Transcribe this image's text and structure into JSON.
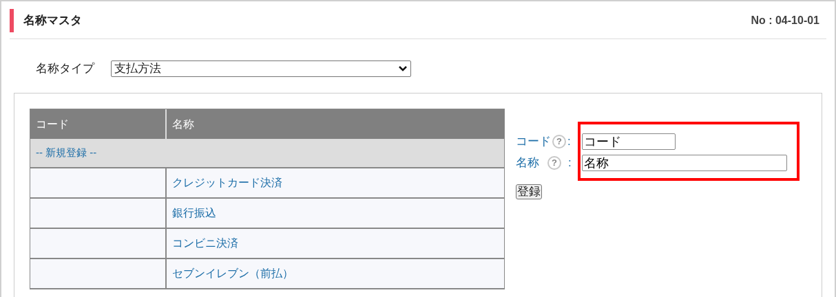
{
  "header": {
    "title": "名称マスタ",
    "screen_no": "No : 04-10-01"
  },
  "name_type": {
    "label": "名称タイプ",
    "value": "支払方法"
  },
  "table": {
    "columns": [
      "コード",
      "名称"
    ],
    "new_entry": "-- 新規登録 --",
    "rows": [
      {
        "code": "",
        "name": "クレジットカード決済"
      },
      {
        "code": "",
        "name": "銀行振込"
      },
      {
        "code": "",
        "name": "コンビニ決済"
      },
      {
        "code": "",
        "name": "セブンイレブン（前払）"
      }
    ]
  },
  "form": {
    "fields": [
      {
        "label": "コード",
        "help": "?",
        "separator": ":",
        "value": "コード",
        "kind": "short"
      },
      {
        "label": "名称",
        "help": "?",
        "separator": ":",
        "value": "名称",
        "kind": "long"
      }
    ],
    "highlighted": true,
    "submit": "登録"
  }
}
